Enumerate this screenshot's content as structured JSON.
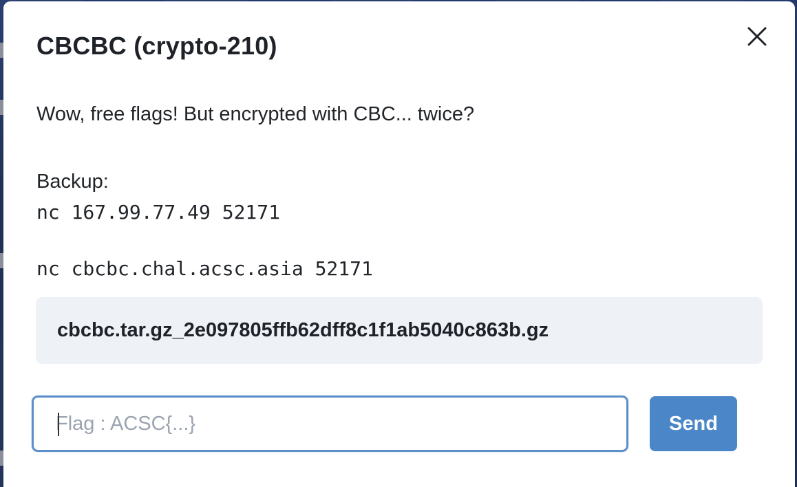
{
  "modal": {
    "title": "CBCBC (crypto-210)",
    "close_icon": "close-icon",
    "description": "Wow, free flags! But encrypted with CBC... twice?",
    "backup_label": "Backup:",
    "backup_host": "nc 167.99.77.49 52171",
    "main_host": "nc cbcbc.chal.acsc.asia 52171",
    "attachment": "cbcbc.tar.gz_2e097805ffb62dff8c1f1ab5040c863b.gz",
    "flag_input": {
      "value": "",
      "placeholder": "Flag : ACSC{...}"
    },
    "send_label": "Send"
  },
  "colors": {
    "primary": "#4a86c8",
    "input_border": "#5d8fcb",
    "file_box_bg": "#eef1f6",
    "text": "#212529"
  }
}
